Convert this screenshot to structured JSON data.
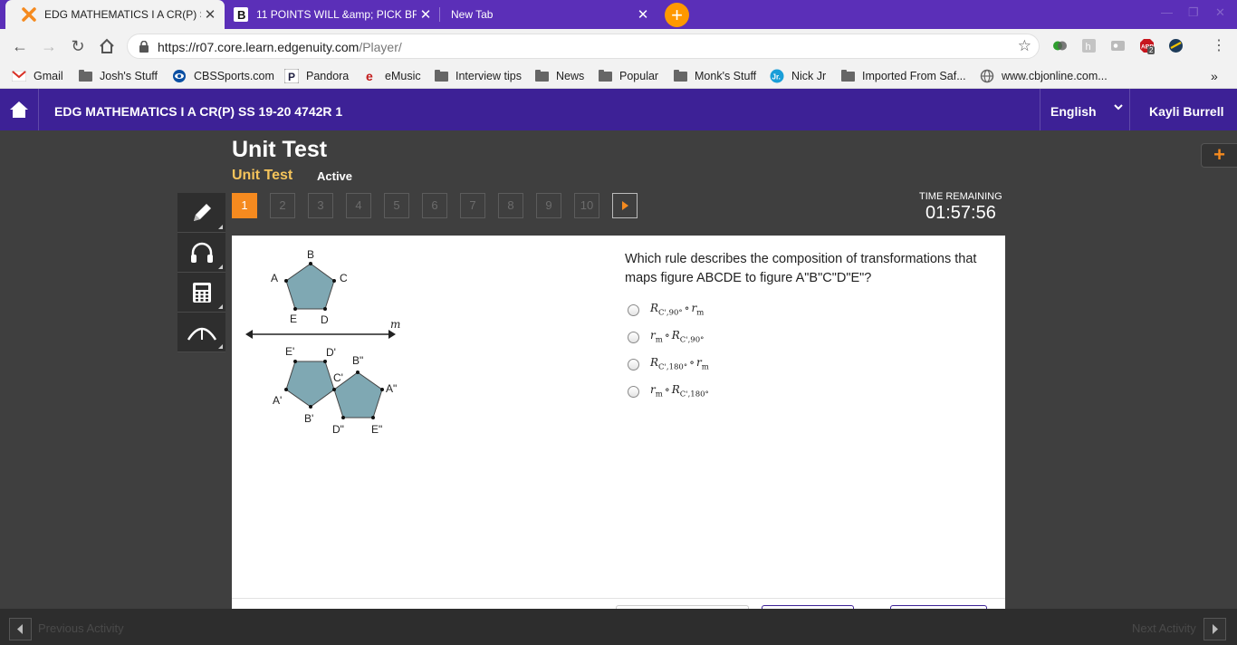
{
  "browser": {
    "tabs": [
      {
        "title": "EDG MATHEMATICS I A CR(P) SS",
        "icon": "edgenuity-x-icon"
      },
      {
        "title": "11 POINTS WILL &amp; PICK BR",
        "icon": "brainly-icon"
      },
      {
        "title": "New Tab",
        "icon": ""
      }
    ],
    "url_host": "https://r07.core.learn.edgenuity.com",
    "url_path": "/Player/",
    "extension_badge": "2",
    "bookmarks": [
      {
        "label": "Gmail",
        "icon": "gmail-icon"
      },
      {
        "label": "Josh's Stuff",
        "icon": "folder-icon"
      },
      {
        "label": "CBSSports.com",
        "icon": "cbs-eye-icon"
      },
      {
        "label": "Pandora",
        "icon": "pandora-icon"
      },
      {
        "label": "eMusic",
        "icon": "emusic-icon"
      },
      {
        "label": "Interview tips",
        "icon": "folder-icon"
      },
      {
        "label": "News",
        "icon": "folder-icon"
      },
      {
        "label": "Popular",
        "icon": "folder-icon"
      },
      {
        "label": "Monk's Stuff",
        "icon": "folder-icon"
      },
      {
        "label": "Nick Jr",
        "icon": "nickjr-icon"
      },
      {
        "label": "Imported From Saf...",
        "icon": "folder-icon"
      },
      {
        "label": "www.cbjonline.com...",
        "icon": "globe-icon"
      }
    ],
    "more_bookmarks": "»"
  },
  "app": {
    "course_title": "EDG MATHEMATICS I A CR(P) SS 19-20 4742R 1",
    "language": "English",
    "user": "Kayli Burrell",
    "unit_title": "Unit Test",
    "unit_subtitle": "Unit Test",
    "status": "Active",
    "time_label": "TIME REMAINING",
    "time_value": "01:57:56",
    "question_numbers": [
      "1",
      "2",
      "3",
      "4",
      "5",
      "6",
      "7",
      "8",
      "9",
      "10"
    ],
    "current_question": "1",
    "prev_activity": "Previous Activity",
    "next_activity": "Next Activity"
  },
  "question": {
    "prompt": "Which rule describes the composition of transformations that maps figure ABCDE to figure A\"B\"C\"D\"E\"?",
    "choices": [
      {
        "first": "R",
        "first_sub": "C',90°",
        "op": "∘",
        "second": "r",
        "second_sub": "m"
      },
      {
        "first": "r",
        "first_sub": "m",
        "op": "∘",
        "second": "R",
        "second_sub": "C',90°"
      },
      {
        "first": "R",
        "first_sub": "C',180°",
        "op": "∘",
        "second": "r",
        "second_sub": "m"
      },
      {
        "first": "r",
        "first_sub": "m",
        "op": "∘",
        "second": "R",
        "second_sub": "C',180°"
      }
    ],
    "figure": {
      "line_label": "m",
      "original_labels": [
        "A",
        "B",
        "C",
        "D",
        "E"
      ],
      "reflected_labels": [
        "A'",
        "B'",
        "C'",
        "D'",
        "E'"
      ],
      "final_labels": [
        "A\"",
        "B\"",
        "D\"",
        "E\""
      ],
      "fill_color": "#7fa8b3"
    }
  },
  "colors": {
    "browser_frame": "#5b2fb8",
    "app_header": "#3d2196",
    "accent_orange": "#f58a1f",
    "unit_subtitle": "#f5c45b",
    "workspace": "#3f3f3f"
  }
}
